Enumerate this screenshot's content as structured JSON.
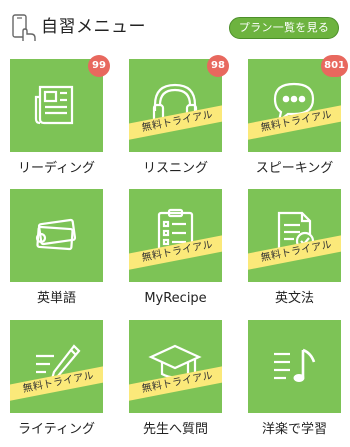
{
  "header": {
    "title": "自習メニュー",
    "icon": "phone-hand-icon",
    "plan_button": "プラン一覧を見る"
  },
  "colors": {
    "tile": "#7dc356",
    "ribbon": "#fbe97a",
    "badge": "#e8685e",
    "button": "#6db33f"
  },
  "ribbon_text": "無料トライアル",
  "tiles": [
    {
      "label": "リーディング",
      "icon": "newspaper-icon",
      "badge": "99",
      "trial": false
    },
    {
      "label": "リスニング",
      "icon": "headphones-icon",
      "badge": "98",
      "trial": true
    },
    {
      "label": "スピーキング",
      "icon": "speech-bubble-icon",
      "badge": "801",
      "trial": true
    },
    {
      "label": "英単語",
      "icon": "flashcards-icon",
      "badge": "",
      "trial": false
    },
    {
      "label": "MyRecipe",
      "icon": "clipboard-checklist-icon",
      "badge": "",
      "trial": true
    },
    {
      "label": "英文法",
      "icon": "document-check-icon",
      "badge": "",
      "trial": true
    },
    {
      "label": "ライティング",
      "icon": "pencil-lines-icon",
      "badge": "",
      "trial": true
    },
    {
      "label": "先生へ質問",
      "icon": "graduation-cap-icon",
      "badge": "",
      "trial": true
    },
    {
      "label": "洋楽で学習",
      "icon": "music-note-icon",
      "badge": "",
      "trial": false
    }
  ]
}
